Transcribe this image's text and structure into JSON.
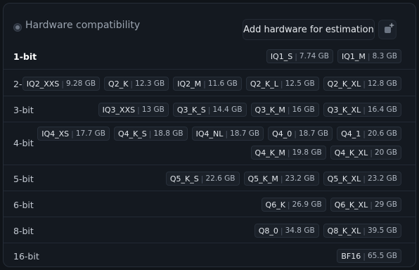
{
  "header": {
    "title": "Hardware compatibility",
    "add_button": "Add hardware for estimation"
  },
  "rows": [
    {
      "label": "1-bit",
      "chips": [
        {
          "name": "IQ1_S",
          "size": "7.74 GB"
        },
        {
          "name": "IQ1_M",
          "size": "8.3 GB"
        }
      ]
    },
    {
      "label": "2-bit",
      "chips": [
        {
          "name": "IQ2_XXS",
          "size": "9.28 GB"
        },
        {
          "name": "Q2_K",
          "size": "12.3 GB"
        },
        {
          "name": "IQ2_M",
          "size": "11.6 GB"
        },
        {
          "name": "Q2_K_L",
          "size": "12.5 GB"
        },
        {
          "name": "Q2_K_XL",
          "size": "12.8 GB"
        }
      ]
    },
    {
      "label": "3-bit",
      "chips": [
        {
          "name": "IQ3_XXS",
          "size": "13 GB"
        },
        {
          "name": "Q3_K_S",
          "size": "14.4 GB"
        },
        {
          "name": "Q3_K_M",
          "size": "16 GB"
        },
        {
          "name": "Q3_K_XL",
          "size": "16.4 GB"
        }
      ]
    },
    {
      "label": "4-bit",
      "chips": [
        {
          "name": "IQ4_XS",
          "size": "17.7 GB"
        },
        {
          "name": "Q4_K_S",
          "size": "18.8 GB"
        },
        {
          "name": "IQ4_NL",
          "size": "18.7 GB"
        },
        {
          "name": "Q4_0",
          "size": "18.7 GB"
        },
        {
          "name": "Q4_1",
          "size": "20.6 GB"
        }
      ],
      "chips2": [
        {
          "name": "Q4_K_M",
          "size": "19.8 GB"
        },
        {
          "name": "Q4_K_XL",
          "size": "20 GB"
        }
      ]
    },
    {
      "label": "5-bit",
      "chips": [
        {
          "name": "Q5_K_S",
          "size": "22.6 GB"
        },
        {
          "name": "Q5_K_M",
          "size": "23.2 GB"
        },
        {
          "name": "Q5_K_XL",
          "size": "23.2 GB"
        }
      ]
    },
    {
      "label": "6-bit",
      "chips": [
        {
          "name": "Q6_K",
          "size": "26.9 GB"
        },
        {
          "name": "Q6_K_XL",
          "size": "29 GB"
        }
      ]
    },
    {
      "label": "8-bit",
      "chips": [
        {
          "name": "Q8_0",
          "size": "34.8 GB"
        },
        {
          "name": "Q8_K_XL",
          "size": "39.5 GB"
        }
      ]
    },
    {
      "label": "16-bit",
      "chips": [
        {
          "name": "BF16",
          "size": "65.5 GB"
        }
      ]
    }
  ]
}
